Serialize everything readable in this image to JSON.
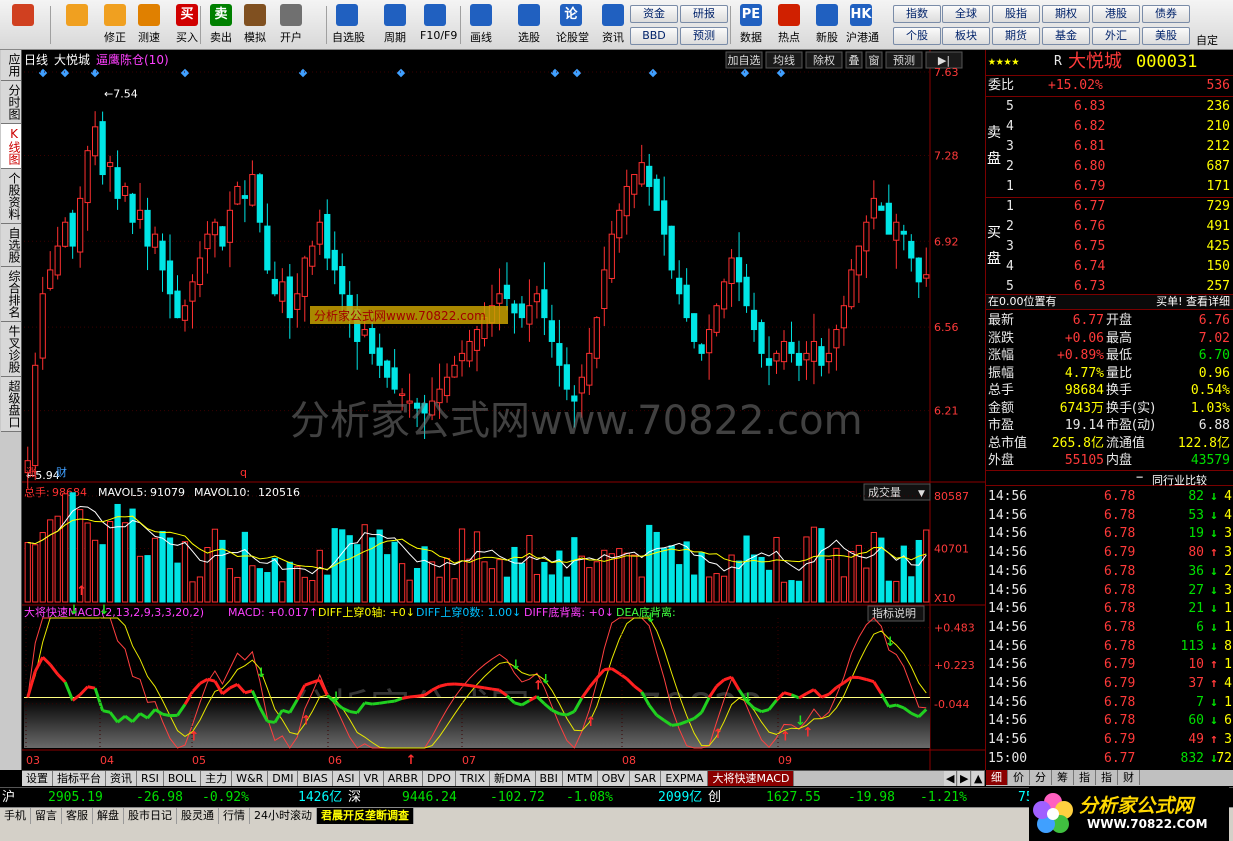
{
  "toolbar": {
    "buttons": [
      {
        "label": "",
        "icon": "windows-icon",
        "color": "#d04020"
      },
      {
        "label": "",
        "icon": "back-arrow-icon",
        "color": "#f0a020"
      },
      {
        "label": "修正",
        "icon": "up-down-icon",
        "color": "#f0a020"
      },
      {
        "label": "测速",
        "icon": "speed-icon",
        "color": "#e08000"
      },
      {
        "label": "买入",
        "icon": "buy-icon",
        "color": "#d00000",
        "glyph": "买"
      },
      {
        "label": "卖出",
        "icon": "sell-icon",
        "color": "#008000",
        "glyph": "卖"
      },
      {
        "label": "模拟",
        "icon": "hammer-icon",
        "color": "#805020"
      },
      {
        "label": "开户",
        "icon": "lock-icon",
        "color": "#707070"
      },
      {
        "label": "自选股",
        "icon": "star-icon",
        "color": "#2060c0"
      },
      {
        "label": "周期",
        "icon": "clock-icon",
        "color": "#2060c0"
      },
      {
        "label": "F10/F9",
        "icon": "document-icon",
        "color": "#2060c0"
      },
      {
        "label": "画线",
        "icon": "pen-icon",
        "color": "#2060c0"
      },
      {
        "label": "选股",
        "icon": "screen-icon",
        "color": "#2060c0"
      },
      {
        "label": "论股堂",
        "icon": "discuss-icon",
        "color": "#2060c0",
        "glyph": "论"
      },
      {
        "label": "资讯",
        "icon": "news-icon",
        "color": "#2060c0"
      },
      {
        "label": "数据",
        "icon": "pe-icon",
        "color": "#2060c0",
        "glyph": "PE"
      },
      {
        "label": "热点",
        "icon": "hot-icon",
        "color": "#d02000"
      },
      {
        "label": "新股",
        "icon": "new-stock-icon",
        "color": "#2060c0"
      },
      {
        "label": "沪港通",
        "icon": "hk-icon",
        "color": "#2060c0",
        "glyph": "HK"
      }
    ],
    "small_buttons": [
      "资金",
      "研报",
      "BBD",
      "预测",
      "指数",
      "全球",
      "股指",
      "期权",
      "港股",
      "债券",
      "个股",
      "板块",
      "期货",
      "基金",
      "外汇",
      "美股"
    ],
    "extra_label": "自定"
  },
  "left_tabs": [
    {
      "label": "应用",
      "active": false
    },
    {
      "label": "分时图",
      "active": false
    },
    {
      "label": "K线图",
      "active": true
    },
    {
      "label": "个股资料",
      "active": false
    },
    {
      "label": "自选股",
      "active": false
    },
    {
      "label": "综合排名",
      "active": false
    },
    {
      "label": "牛叉诊股",
      "active": false
    },
    {
      "label": "超级盘口",
      "active": false
    }
  ],
  "chart_header": {
    "period": "日线",
    "stock": "大悦城",
    "indicator": "逼鹰陈仓(10)",
    "buttons": [
      "加自选",
      "均线",
      "除权",
      "叠",
      "窗",
      "预测",
      "▶|"
    ]
  },
  "price_chart": {
    "high_label": "7.54",
    "low_label": "5.94",
    "y_ticks": [
      "7.63",
      "7.28",
      "6.92",
      "6.56",
      "6.21"
    ],
    "watermark_box": "分析家公式网www.70822.com",
    "watermark": "分析家公式网www.70822.com",
    "event_labels": [
      "涨",
      "财",
      "q"
    ]
  },
  "volume_chart": {
    "header_total_label": "总手:",
    "header_total": "98684",
    "mavol5_label": "MAVOL5:",
    "mavol5": "91079",
    "mavol10_label": "MAVOL10:",
    "mavol10": "120516",
    "dropdown": "成交量",
    "y_ticks": [
      "80587",
      "40701",
      "X10"
    ]
  },
  "macd_chart": {
    "title": "大将快速MACD(2,13,2,9,3,3,20,2)",
    "macd_label": "MACD: +0.017↑",
    "diff0": "DIFF上穿0轴: +0↓",
    "diffcount": "DIFF上穿0数: 1.00↓",
    "diffdiv": "DIFF底背离: +0↓",
    "deadiv": "DEA底背离:",
    "explain": "指标说明",
    "y_ticks": [
      "+0.483",
      "+0.223",
      "-0.044"
    ],
    "months": [
      "03",
      "04",
      "05",
      "06",
      "07",
      "08",
      "09"
    ]
  },
  "chart_data": {
    "type": "candlestick",
    "x_months": [
      "03",
      "04",
      "05",
      "06",
      "07",
      "08",
      "09"
    ],
    "price_ylim": [
      5.94,
      7.63
    ],
    "price_max": 7.54,
    "price_min": 5.94,
    "close_series": [
      6.0,
      6.4,
      6.7,
      6.8,
      6.9,
      7.0,
      6.9,
      7.1,
      7.3,
      7.4,
      7.2,
      7.25,
      7.1,
      7.15,
      7.0,
      7.05,
      6.9,
      6.95,
      6.8,
      6.7,
      6.6,
      6.65,
      6.75,
      6.85,
      6.95,
      7.0,
      6.9,
      7.05,
      7.15,
      7.1,
      7.2,
      7.0,
      6.8,
      6.7,
      6.75,
      6.6,
      6.7,
      6.85,
      6.9,
      7.0,
      6.85,
      6.8,
      6.7,
      6.6,
      6.5,
      6.55,
      6.45,
      6.4,
      6.35,
      6.3,
      6.28,
      6.25,
      6.22,
      6.2,
      6.25,
      6.3,
      6.35,
      6.4,
      6.45,
      6.5,
      6.55,
      6.6,
      6.65,
      6.7,
      6.68,
      6.62,
      6.6,
      6.65,
      6.7,
      6.6,
      6.5,
      6.4,
      6.3,
      6.25,
      6.35,
      6.45,
      6.6,
      6.8,
      6.95,
      7.05,
      7.15,
      7.2,
      7.25,
      7.15,
      7.05,
      6.95,
      6.8,
      6.7,
      6.6,
      6.5,
      6.45,
      6.55,
      6.65,
      6.75,
      6.85,
      6.75,
      6.65,
      6.55,
      6.45,
      6.4,
      6.45,
      6.5,
      6.45,
      6.4,
      6.45,
      6.5,
      6.4,
      6.45,
      6.55,
      6.65,
      6.8,
      6.9,
      7.0,
      7.1,
      7.05,
      6.95,
      7.0,
      6.95,
      6.85,
      6.75,
      6.78
    ],
    "volume_ylim": [
      0,
      80587
    ],
    "volume_ticks": [
      80587,
      40701
    ],
    "macd_ylim": [
      -0.35,
      0.55
    ],
    "macd_ticks": [
      0.483,
      0.223,
      -0.044
    ]
  },
  "right_panel": {
    "stars": "★★★★",
    "r_mark": "R",
    "name": "大悦城",
    "code": "000031",
    "webi_label": "委比",
    "webi": "+15.02%",
    "webi_diff": "536",
    "sell_label": "卖盘",
    "buy_label": "买盘",
    "sells": [
      {
        "lvl": "5",
        "price": "6.83",
        "vol": "236"
      },
      {
        "lvl": "4",
        "price": "6.82",
        "vol": "210"
      },
      {
        "lvl": "3",
        "price": "6.81",
        "vol": "212"
      },
      {
        "lvl": "2",
        "price": "6.80",
        "vol": "687"
      },
      {
        "lvl": "1",
        "price": "6.79",
        "vol": "171"
      }
    ],
    "buys": [
      {
        "lvl": "1",
        "price": "6.77",
        "vol": "729"
      },
      {
        "lvl": "2",
        "price": "6.76",
        "vol": "491"
      },
      {
        "lvl": "3",
        "price": "6.75",
        "vol": "425"
      },
      {
        "lvl": "4",
        "price": "6.74",
        "vol": "150"
      },
      {
        "lvl": "5",
        "price": "6.73",
        "vol": "257"
      }
    ],
    "pos_left": "在0.00位置有",
    "pos_right": "买单! 查看详细",
    "stats": [
      {
        "l1": "最新",
        "v1": "6.77",
        "c1": "red",
        "l2": "开盘",
        "v2": "6.76",
        "c2": "red"
      },
      {
        "l1": "涨跌",
        "v1": "+0.06",
        "c1": "red",
        "l2": "最高",
        "v2": "7.02",
        "c2": "red"
      },
      {
        "l1": "涨幅",
        "v1": "+0.89%",
        "c1": "red",
        "l2": "最低",
        "v2": "6.70",
        "c2": "grn"
      },
      {
        "l1": "振幅",
        "v1": "4.77%",
        "c1": "yel",
        "l2": "量比",
        "v2": "0.96",
        "c2": "yel"
      },
      {
        "l1": "总手",
        "v1": "98684",
        "c1": "yel",
        "l2": "换手",
        "v2": "0.54%",
        "c2": "yel"
      },
      {
        "l1": "金额",
        "v1": "6743万",
        "c1": "yel",
        "l2": "换手(实)",
        "v2": "1.03%",
        "c2": "yel"
      },
      {
        "l1": "市盈",
        "v1": "19.14",
        "c1": "wht",
        "l2": "市盈(动)",
        "v2": "6.88",
        "c2": "wht"
      },
      {
        "l1": "总市值",
        "v1": "265.8亿",
        "c1": "yel",
        "l2": "流通值",
        "v2": "122.8亿",
        "c2": "yel"
      },
      {
        "l1": "外盘",
        "v1": "55105",
        "c1": "red",
        "l2": "内盘",
        "v2": "43579",
        "c2": "grn"
      }
    ],
    "compare_btn": "同行业比较",
    "ticks": [
      {
        "t": "14:56",
        "p": "6.78",
        "v": "82",
        "d": "down",
        "x": "4"
      },
      {
        "t": "14:56",
        "p": "6.78",
        "v": "53",
        "d": "down",
        "x": "4"
      },
      {
        "t": "14:56",
        "p": "6.78",
        "v": "19",
        "d": "down",
        "x": "3"
      },
      {
        "t": "14:56",
        "p": "6.79",
        "v": "80",
        "d": "up",
        "x": "3"
      },
      {
        "t": "14:56",
        "p": "6.78",
        "v": "36",
        "d": "down",
        "x": "2"
      },
      {
        "t": "14:56",
        "p": "6.78",
        "v": "27",
        "d": "down",
        "x": "3"
      },
      {
        "t": "14:56",
        "p": "6.78",
        "v": "21",
        "d": "down",
        "x": "1"
      },
      {
        "t": "14:56",
        "p": "6.78",
        "v": "6",
        "d": "down",
        "x": "1"
      },
      {
        "t": "14:56",
        "p": "6.78",
        "v": "113",
        "d": "down",
        "x": "8"
      },
      {
        "t": "14:56",
        "p": "6.79",
        "v": "10",
        "d": "up",
        "x": "1"
      },
      {
        "t": "14:56",
        "p": "6.79",
        "v": "37",
        "d": "up",
        "x": "4"
      },
      {
        "t": "14:56",
        "p": "6.78",
        "v": "7",
        "d": "down",
        "x": "1"
      },
      {
        "t": "14:56",
        "p": "6.78",
        "v": "60",
        "d": "down",
        "x": "6"
      },
      {
        "t": "14:56",
        "p": "6.79",
        "v": "49",
        "d": "up",
        "x": "3"
      },
      {
        "t": "15:00",
        "p": "6.77",
        "v": "832",
        "d": "down",
        "x": "72"
      }
    ],
    "bottom_tabs": [
      "细",
      "价",
      "分",
      "筹",
      "指",
      "指",
      "财"
    ]
  },
  "bottom_tabs": [
    "设置",
    "指标平台",
    "资讯",
    "RSI",
    "BOLL",
    "主力",
    "W&R",
    "DMI",
    "BIAS",
    "ASI",
    "VR",
    "ARBR",
    "DPO",
    "TRIX",
    "新DMA",
    "BBI",
    "MTM",
    "OBV",
    "SAR",
    "EXPMA",
    "大将快速MACD"
  ],
  "ticker": {
    "sh_label": "沪",
    "sh_index": "2905.19",
    "sh_chg": "-26.98",
    "sh_pct": "-0.92%",
    "sh_amt": "1426亿",
    "sz_label": "深",
    "sz_index": "9446.24",
    "sz_chg": "-102.72",
    "sz_pct": "-1.08%",
    "sz_amt": "2099亿",
    "cy_label": "创",
    "cy_index": "1627.55",
    "cy_chg": "-19.98",
    "cy_pct": "-1.21%",
    "tail": "75"
  },
  "statusbar": {
    "items": [
      "手机",
      "留言",
      "客服",
      "解盘",
      "股市日记",
      "股灵通",
      "行情",
      "24小时滚动"
    ],
    "news": "君晨开反垄断调查"
  },
  "logo": {
    "text": "分析家公式网",
    "url": "WWW.70822.COM"
  }
}
